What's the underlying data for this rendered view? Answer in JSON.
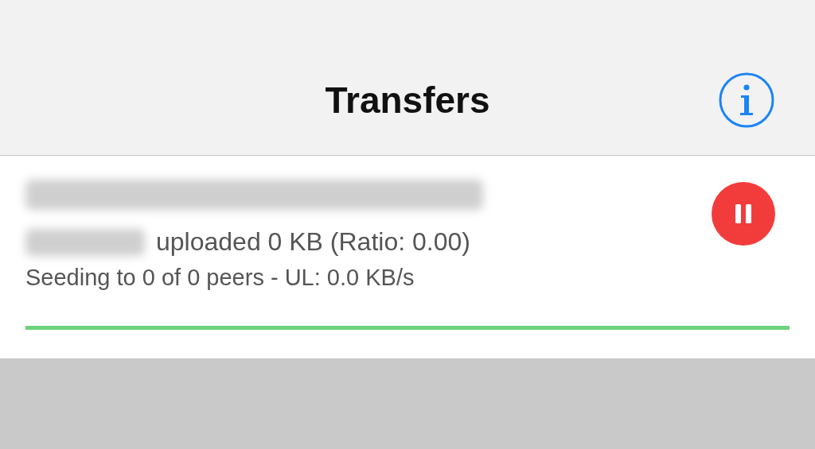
{
  "nav_bar": {
    "title": "Transfers"
  },
  "transfers": [
    {
      "details": "uploaded 0 KB (Ratio: 0.00)",
      "status": "Seeding to 0 of 0 peers - UL: 0.0 KB/s",
      "level": 1.0,
      "paused": false
    }
  ]
}
